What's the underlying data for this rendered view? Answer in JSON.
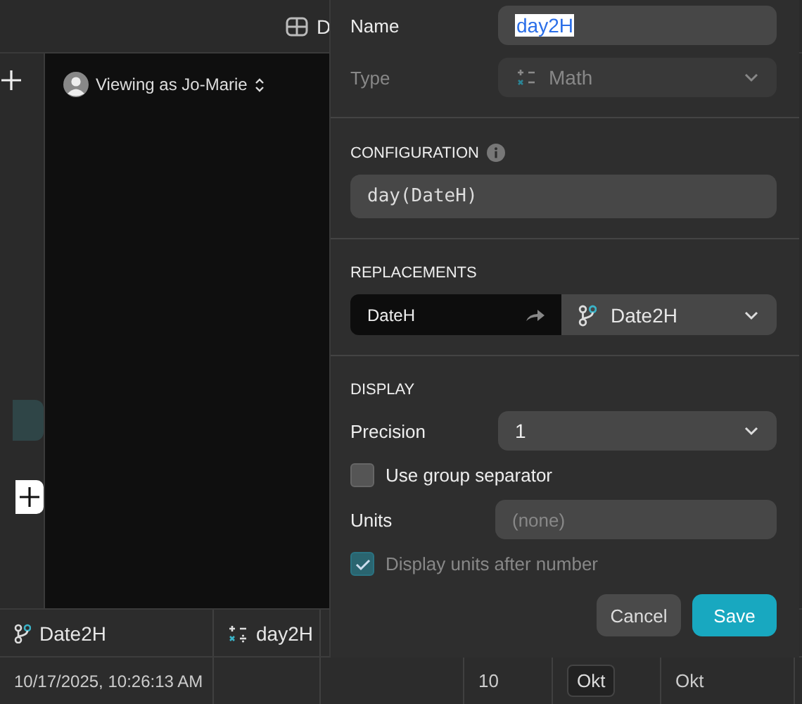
{
  "top_bar": {
    "title": "D"
  },
  "viewer": {
    "prefix": "Viewing as",
    "user": "Jo-Marie"
  },
  "dialog": {
    "name": {
      "label": "Name",
      "value": "day2H",
      "selected": true
    },
    "type": {
      "label": "Type",
      "value": "Math",
      "disabled": true
    },
    "configuration": {
      "heading": "CONFIGURATION",
      "formula": "day(DateH)"
    },
    "replacements": {
      "heading": "REPLACEMENTS",
      "source": "DateH",
      "target": "Date2H"
    },
    "display": {
      "heading": "DISPLAY",
      "precision": {
        "label": "Precision",
        "value": "1"
      },
      "group_separator": {
        "label": "Use group separator",
        "checked": false
      },
      "units": {
        "label": "Units",
        "placeholder": "(none)"
      },
      "units_after": {
        "label": "Display units after number",
        "checked": true,
        "disabled": true
      }
    },
    "buttons": [
      {
        "label": "Cancel",
        "kind": "secondary"
      },
      {
        "label": "Save",
        "kind": "primary"
      }
    ]
  },
  "table": {
    "columns": [
      {
        "label": "Date2H",
        "kind": "lookup"
      },
      {
        "label": "day2H",
        "kind": "math"
      }
    ],
    "row": [
      {
        "kind": "plain",
        "text": "10/17/2025, 10:26:13 AM"
      },
      {
        "kind": "empty"
      },
      {
        "kind": "empty"
      },
      {
        "kind": "plain",
        "text": "10"
      },
      {
        "kind": "chip",
        "text": "Okt"
      },
      {
        "kind": "plain",
        "text": "Okt"
      }
    ]
  }
}
